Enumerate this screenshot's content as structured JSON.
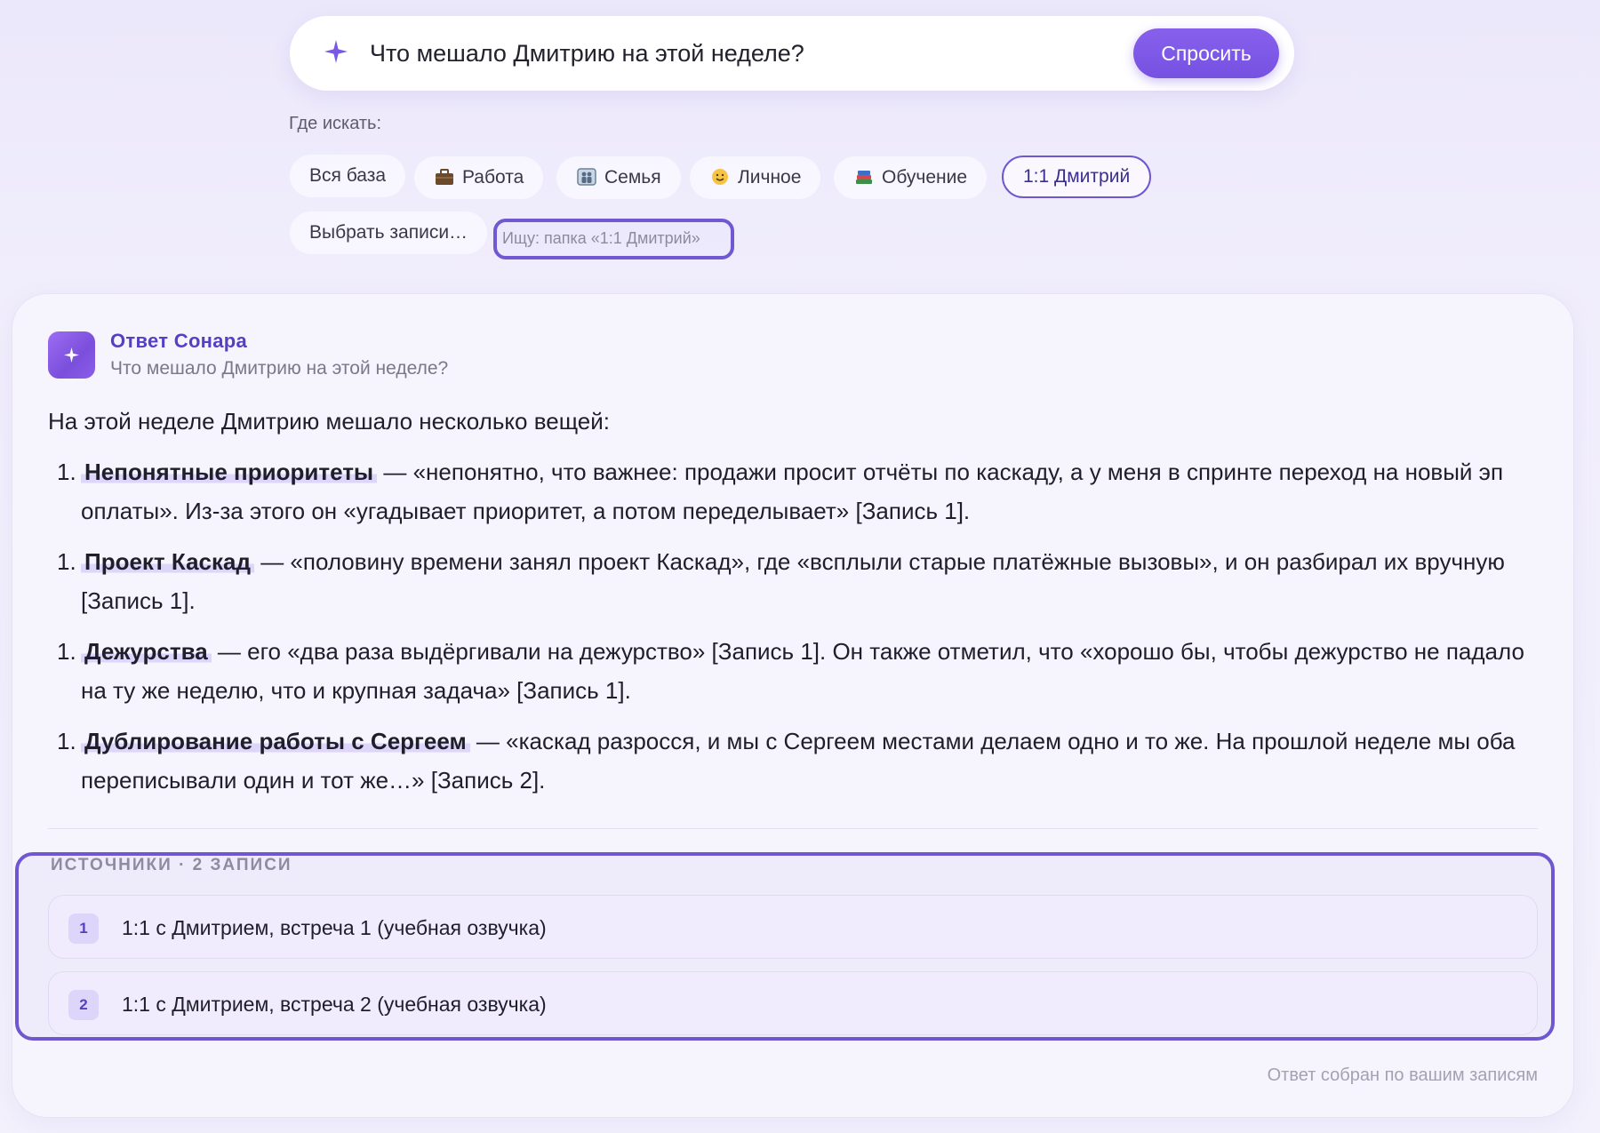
{
  "search": {
    "query": "Что мешало Дмитрию на этой неделе?",
    "ask_label": "Спросить",
    "accent": "#7651e2"
  },
  "filters": {
    "label": "Где искать:",
    "chips": [
      {
        "label": "Вся база",
        "icon": null
      },
      {
        "label": "Работа",
        "icon": "briefcase-icon"
      },
      {
        "label": "Семья",
        "icon": "family-icon"
      },
      {
        "label": "Личное",
        "icon": "smile-icon"
      },
      {
        "label": "Обучение",
        "icon": "books-icon"
      },
      {
        "label": "1:1 Дмитрий",
        "icon": null,
        "active": true
      }
    ],
    "select_records": "Выбрать записи…",
    "scope_hint": "Ищу: папка «1:1 Дмитрий»"
  },
  "answer": {
    "title": "Ответ Сонара",
    "question": "Что мешало Дмитрию на этой неделе?",
    "intro": "На этой неделе Дмитрию мешало несколько вещей:",
    "items": [
      {
        "num": "1.",
        "heading": "Непонятные приоритеты",
        "text": " — «непонятно, что важнее: продажи просит отчёты по каскаду, а у меня в спринте переход на новый эп оплаты». Из-за этого он «угадывает приоритет, а потом переделывает» [Запись 1]."
      },
      {
        "num": "1.",
        "heading": "Проект Каскад",
        "text": " — «половину времени занял проект Каскад», где «всплыли старые платёжные вызовы», и он разбирал их вручную [Запись 1]."
      },
      {
        "num": "1.",
        "heading": "Дежурства",
        "text": " — его «два раза выдёргивали на дежурство» [Запись 1]. Он также отметил, что «хорошо бы, чтобы дежурство не падало на ту же неделю, что и крупная задача» [Запись 1]."
      },
      {
        "num": "1.",
        "heading": "Дублирование работы с Сергеем",
        "text": " — «каскад разросся, и мы с Сергеем местами делаем одно и то же. На прошлой неделе мы оба переписывали один и тот же…» [Запись 2]."
      }
    ],
    "sources_label": "ИСТОЧНИКИ · 2 ЗАПИСИ",
    "sources": [
      {
        "num": "1",
        "title": "1:1 с Дмитрием, встреча 1 (учебная озвучка)"
      },
      {
        "num": "2",
        "title": "1:1 с Дмитрием, встреча 2 (учебная озвучка)"
      }
    ],
    "footer": "Ответ собран по вашим записям"
  }
}
